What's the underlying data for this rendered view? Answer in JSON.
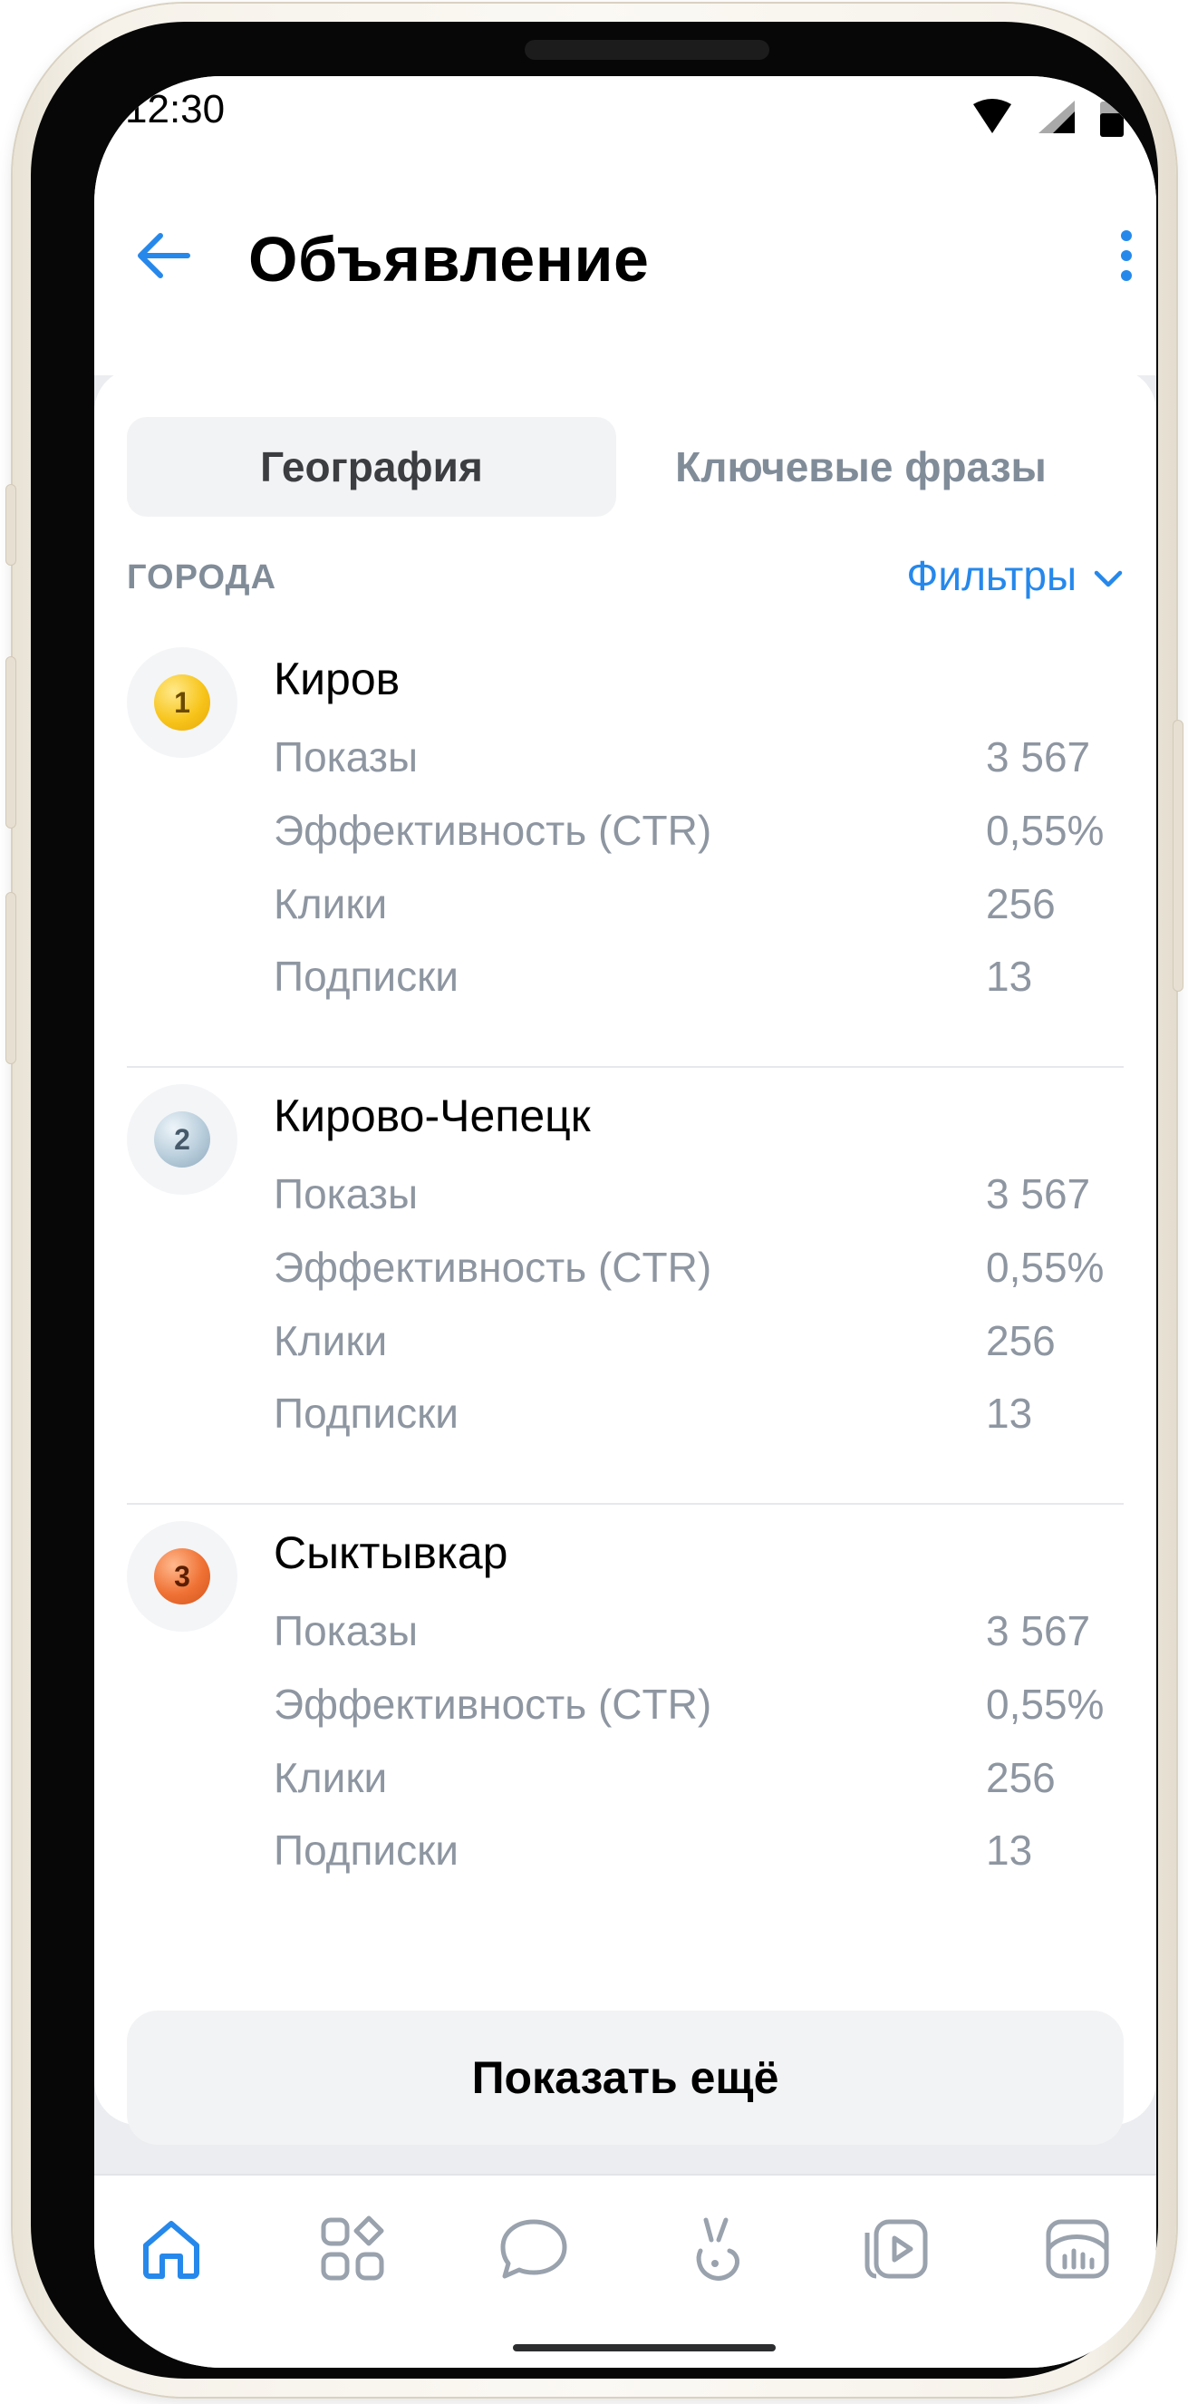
{
  "status_bar": {
    "time": "12:30",
    "icons": [
      "wifi-icon",
      "cellular-signal-icon",
      "battery-icon"
    ]
  },
  "header": {
    "title": "Объявление",
    "back_icon": "arrow-left-icon",
    "menu_icon": "more-vertical-icon"
  },
  "tabs": [
    {
      "label": "География",
      "active": true
    },
    {
      "label": "Ключевые фразы",
      "active": false
    }
  ],
  "section": {
    "title": "ГОРОДА",
    "filter_label": "Фильтры",
    "filter_icon": "chevron-down-icon"
  },
  "cities": [
    {
      "rank": "1",
      "name": "Киров",
      "metrics": [
        {
          "label": "Показы",
          "value": "3 567"
        },
        {
          "label": "Эффективность (CTR)",
          "value": "0,55%"
        },
        {
          "label": "Клики",
          "value": "256"
        },
        {
          "label": "Подписки",
          "value": "13"
        }
      ]
    },
    {
      "rank": "2",
      "name": "Кирово-Чепецк",
      "metrics": [
        {
          "label": "Показы",
          "value": "3 567"
        },
        {
          "label": "Эффективность (CTR)",
          "value": "0,55%"
        },
        {
          "label": "Клики",
          "value": "256"
        },
        {
          "label": "Подписки",
          "value": "13"
        }
      ]
    },
    {
      "rank": "3",
      "name": "Сыктывкар",
      "metrics": [
        {
          "label": "Показы",
          "value": "3 567"
        },
        {
          "label": "Эффективность (CTR)",
          "value": "0,55%"
        },
        {
          "label": "Клики",
          "value": "256"
        },
        {
          "label": "Подписки",
          "value": "13"
        }
      ]
    }
  ],
  "show_more_label": "Показать ещё",
  "tabbar": {
    "items": [
      "home-icon",
      "services-icon",
      "messages-icon",
      "clips-icon",
      "video-icon",
      "statistics-icon"
    ],
    "active_index": 0
  },
  "colors": {
    "accent": "#2688eb",
    "secondary_text": "#818c99",
    "background": "#ebedf0",
    "rank_1": "#f5c518",
    "rank_2": "#a9bfd0",
    "rank_3": "#ec6a2c"
  }
}
